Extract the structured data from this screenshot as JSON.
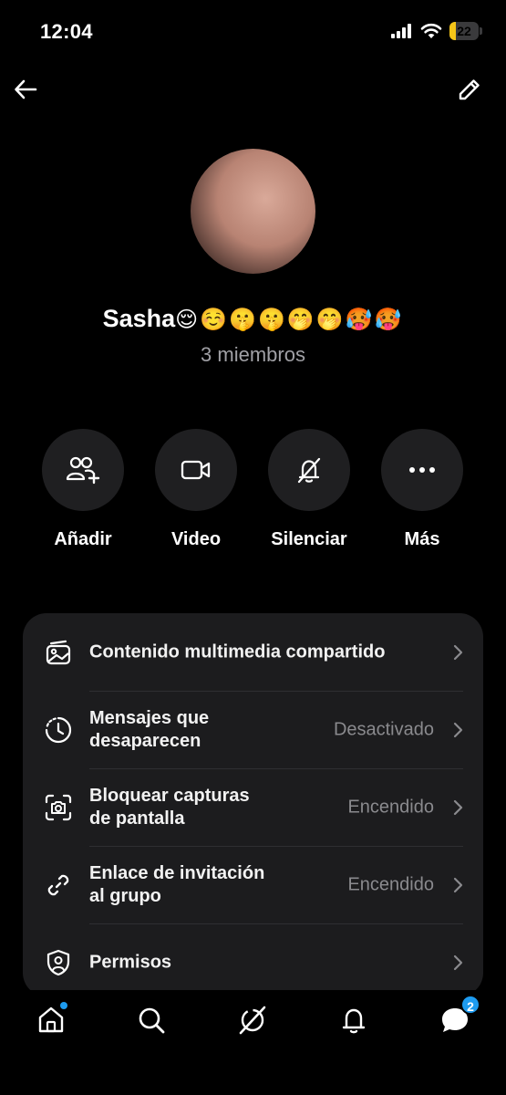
{
  "status_bar": {
    "time": "12:04",
    "battery": "22",
    "battery_level": 0.22,
    "battery_color": "#f5c518"
  },
  "header": {
    "back_icon": "arrow-left-icon",
    "edit_icon": "pencil-icon"
  },
  "group": {
    "name": "Sasha",
    "emoji": "😌☺️🤫🤫🤭🤭🥵🥵",
    "members": "3 miembros"
  },
  "actions": [
    {
      "label": "Añadir",
      "icon": "add-people-icon"
    },
    {
      "label": "Video",
      "icon": "video-camera-icon"
    },
    {
      "label": "Silenciar",
      "icon": "bell-off-icon"
    },
    {
      "label": "Más",
      "icon": "more-dots-icon"
    }
  ],
  "settings": [
    {
      "label": "Contenido multimedia compartido",
      "value": "",
      "icon": "media-gallery-icon"
    },
    {
      "label": "Mensajes que desaparecen",
      "value": "Desactivado",
      "icon": "timer-icon"
    },
    {
      "label": "Bloquear capturas de pantalla",
      "value": "Encendido",
      "icon": "screenshot-camera-icon"
    },
    {
      "label": "Enlace de invitación al grupo",
      "value": "Encendido",
      "icon": "link-icon"
    },
    {
      "label": "Permisos",
      "value": "",
      "icon": "shield-user-icon"
    }
  ],
  "tabbar": {
    "items": [
      "home-icon",
      "search-icon",
      "grok-icon",
      "notifications-bell-icon",
      "messages-icon"
    ],
    "messages_badge": "2"
  },
  "colors": {
    "accent": "#1d9bf0",
    "card_bg": "#1c1c1e",
    "secondary_text": "#8a8a8e"
  }
}
